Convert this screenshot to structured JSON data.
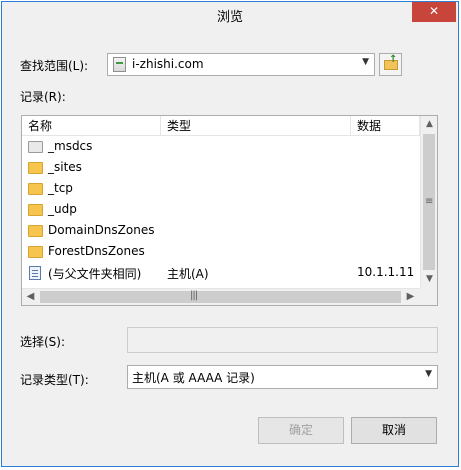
{
  "window": {
    "title": "浏览",
    "close_glyph": "✕"
  },
  "lookin": {
    "label": "查找范围(L):",
    "value": "i-zhishi.com",
    "icon": "server-icon"
  },
  "up_button": {
    "icon": "folder-up-icon"
  },
  "records": {
    "label": "记录(R):",
    "columns": [
      "名称",
      "类型",
      "数据"
    ],
    "rows": [
      {
        "name": "_msdcs",
        "type": "",
        "data": "",
        "icon": "folder-gray"
      },
      {
        "name": "_sites",
        "type": "",
        "data": "",
        "icon": "folder"
      },
      {
        "name": "_tcp",
        "type": "",
        "data": "",
        "icon": "folder"
      },
      {
        "name": "_udp",
        "type": "",
        "data": "",
        "icon": "folder"
      },
      {
        "name": "DomainDnsZones",
        "type": "",
        "data": "",
        "icon": "folder"
      },
      {
        "name": "ForestDnsZones",
        "type": "",
        "data": "",
        "icon": "folder"
      },
      {
        "name": "(与父文件夹相同)",
        "type": "主机(A)",
        "data": "10.1.1.11",
        "icon": "record"
      }
    ]
  },
  "selection": {
    "label": "选择(S):",
    "value": ""
  },
  "record_type": {
    "label": "记录类型(T):",
    "value": "主机(A 或 AAAA 记录)"
  },
  "buttons": {
    "ok": "确定",
    "cancel": "取消"
  }
}
